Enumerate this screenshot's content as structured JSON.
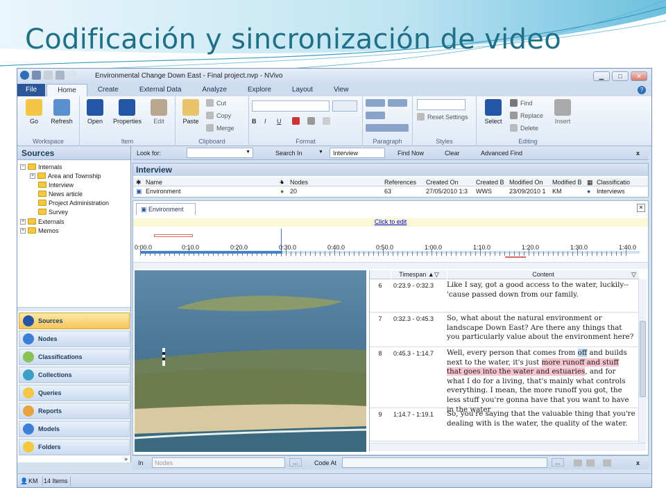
{
  "slide": {
    "title": "Codificación y sincronización de video"
  },
  "window": {
    "title": "Environmental Change Down East - Final project.nvp - NVivo"
  },
  "tabs": [
    "File",
    "Home",
    "Create",
    "External Data",
    "Analyze",
    "Explore",
    "Layout",
    "View"
  ],
  "active_tab": "Home",
  "ribbon": {
    "workspace": {
      "label": "Workspace",
      "go": "Go",
      "refresh": "Refresh"
    },
    "item": {
      "label": "Item",
      "open": "Open",
      "properties": "Properties",
      "edit": "Edit"
    },
    "clipboard": {
      "label": "Clipboard",
      "paste": "Paste",
      "cut": "Cut",
      "copy": "Copy",
      "merge": "Merge"
    },
    "format": {
      "label": "Format",
      "bold": "B",
      "italic": "I",
      "underline": "U"
    },
    "paragraph": {
      "label": "Paragraph"
    },
    "styles": {
      "label": "Styles",
      "reset": "Reset Settings"
    },
    "editing": {
      "label": "Editing",
      "select": "Select",
      "find": "Find",
      "replace": "Replace",
      "delete": "Delete",
      "insert": "Insert"
    }
  },
  "sources": {
    "title": "Sources",
    "tree": [
      {
        "label": "Internals",
        "toggle": "⊟"
      },
      {
        "label": "Area and Township",
        "toggle": "⊞"
      },
      {
        "label": "Interview",
        "toggle": ""
      },
      {
        "label": "News article",
        "toggle": ""
      },
      {
        "label": "Project Administration",
        "toggle": ""
      },
      {
        "label": "Survey",
        "toggle": ""
      },
      {
        "label": "Externals",
        "toggle": "⊞"
      },
      {
        "label": "Memos",
        "toggle": "⊞"
      }
    ]
  },
  "nav": [
    "Sources",
    "Nodes",
    "Classifications",
    "Collections",
    "Queries",
    "Reports",
    "Models",
    "Folders"
  ],
  "findbar": {
    "look_for": "Look for:",
    "search_in": "Search In",
    "search_value": "Interview",
    "find_now": "Find Now",
    "clear": "Clear",
    "advanced": "Advanced Find",
    "close": "x"
  },
  "list": {
    "title": "Interview",
    "columns": [
      "Name",
      "Nodes",
      "References",
      "Created On",
      "Created B",
      "Modified On",
      "Modified B",
      "Classificatio"
    ],
    "row": [
      "Environment",
      "20",
      "63",
      "27/05/2010 1:3",
      "WWS",
      "23/09/2010 1",
      "KM",
      "Interviews"
    ]
  },
  "detail": {
    "tab": "Environment",
    "click_to_edit": "Click to edit",
    "timeline_labels": [
      "0:00.0",
      "0:10.0",
      "0:20.0",
      "0:30.0",
      "0:40.0",
      "0:50.0",
      "1:00.0",
      "1:10.0",
      "1:20.0",
      "1:30.0",
      "1:40.0"
    ],
    "playhead_position": "0:30.0",
    "grid_headers": {
      "timespan": "Timespan",
      "content": "Content"
    },
    "rows": [
      {
        "num": "6",
        "timespan": "0:23.9 - 0:32.3",
        "content": "Like I say, got a good access to the water, luckily-- 'cause passed down from our family."
      },
      {
        "num": "7",
        "timespan": "0:32.3 - 0:45.3",
        "content": "So, what about the natural environment or landscape Down East? Are there any things that you particularly value about the environment here?"
      },
      {
        "num": "8",
        "timespan": "0:45.3 - 1:14.7",
        "content_a": "Well, every person that comes from ",
        "content_b": "off",
        "content_c": " and builds next to the water, it's just ",
        "content_d": "more runoff and stuff that goes into the water and estuaries",
        "content_e": ", and for what I do for a living, that's mainly what controls everything. I mean, the more runoff you got, the less stuff you're gonna have that you want to have in the water"
      },
      {
        "num": "9",
        "timespan": "1:14.7 - 1:19.1",
        "content": "So, you're saying that the valuable thing that you're dealing with is the water, the quality of the water."
      }
    ]
  },
  "codebar": {
    "in": "In",
    "in_value": "Nodes",
    "code_at": "Code At",
    "ellipsis": "...",
    "close": "x"
  },
  "status": {
    "user": "KM",
    "items": "14 Items"
  },
  "colors": {
    "accent": "#2b579a",
    "title": "#1f6f86",
    "highlight": "#f5c4cf"
  }
}
